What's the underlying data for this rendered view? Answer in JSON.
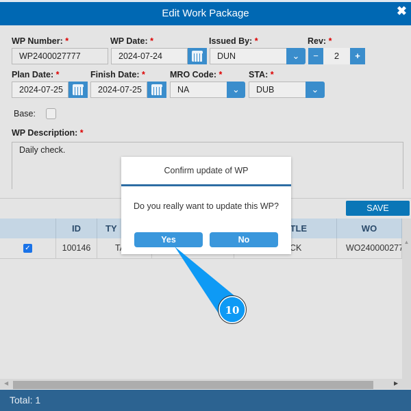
{
  "header": {
    "title": "Edit Work Package",
    "close_icon": "close-icon"
  },
  "form": {
    "wp_number": {
      "label": "WP Number:",
      "value": "WP2400027777"
    },
    "wp_date": {
      "label": "WP Date:",
      "value": "2024-07-24"
    },
    "issued_by": {
      "label": "Issued By:",
      "value": "DUN"
    },
    "rev": {
      "label": "Rev:",
      "value": "2",
      "minus": "−",
      "plus": "+"
    },
    "plan_date": {
      "label": "Plan Date:",
      "value": "2024-07-25"
    },
    "finish_date": {
      "label": "Finish Date:",
      "value": "2024-07-25"
    },
    "mro_code": {
      "label": "MRO Code:",
      "value": "NA"
    },
    "sta": {
      "label": "STA:",
      "value": "DUB"
    },
    "base": {
      "label": "Base:",
      "checked": false
    },
    "description": {
      "label": "WP Description:",
      "value": "Daily check."
    },
    "required_mark": "*"
  },
  "save_label": "SAVE",
  "table": {
    "headers": [
      "",
      "ID",
      "TY",
      "",
      "",
      "TITLE",
      "WO"
    ],
    "rows": [
      {
        "checked": true,
        "id": "100146",
        "type": "TA",
        "title": "CK",
        "wo": "WO240000277"
      }
    ]
  },
  "footer": {
    "total": "Total: 1"
  },
  "dialog": {
    "title": "Confirm update of WP",
    "message": "Do you really want to update this WP?",
    "yes": "Yes",
    "no": "No"
  },
  "callout": {
    "number": "10",
    "color": "#0e9af5"
  }
}
